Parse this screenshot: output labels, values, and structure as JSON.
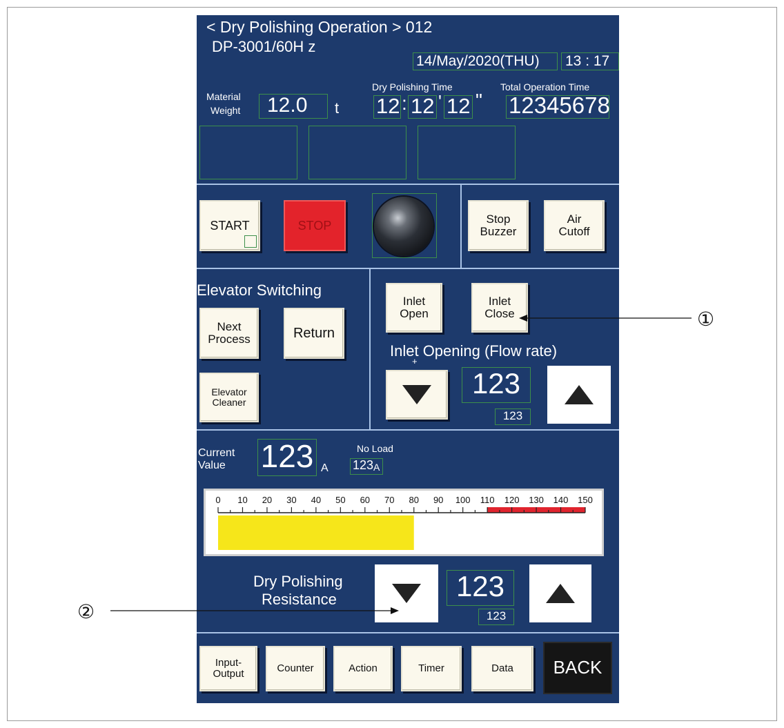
{
  "header": {
    "title": "< Dry Polishing Operation > 012",
    "model": "DP-3001/60H z",
    "date": "14/May/2020(THU)",
    "time": "13 : 17",
    "material_weight_label_1": "Material",
    "material_weight_label_2": "Weight",
    "material_weight_value": "12.0",
    "material_weight_unit": "t",
    "dry_polishing_time_label": "Dry Polishing Time",
    "dry_polishing_time_h": "12",
    "dry_polishing_time_m": "12",
    "dry_polishing_time_s": "12",
    "total_operation_time_label": "Total Operation Time",
    "total_operation_time_value": "12345678"
  },
  "controls": {
    "start_label": "START",
    "stop_label": "STOP",
    "stop_buzzer_label": "Stop Buzzer",
    "air_cutoff_label": "Air Cutoff"
  },
  "elevator": {
    "title": "Elevator Switching",
    "next_process_label": "Next Process",
    "return_label": "Return",
    "elevator_cleaner_label": "Elevator Cleaner"
  },
  "inlet": {
    "open_label": "Inlet Open",
    "close_label": "Inlet Close",
    "opening_label": "Inlet Opening (Flow rate)",
    "value": "123",
    "sub_value": "123"
  },
  "current": {
    "label_1": "Current",
    "label_2": "Value",
    "value": "123",
    "unit": "A",
    "no_load_label": "No Load",
    "no_load_value": "123",
    "no_load_unit": "A"
  },
  "gauge": {
    "scale_labels": [
      "0",
      "10",
      "20",
      "30",
      "40",
      "50",
      "60",
      "70",
      "80",
      "90",
      "100",
      "110",
      "120",
      "130",
      "140",
      "150"
    ],
    "min": 0,
    "max": 150,
    "level": 80,
    "fill_color": "#f6e61a",
    "warning_from": 110,
    "warning_color": "#e0242e"
  },
  "resistance": {
    "label_1": "Dry Polishing",
    "label_2": "Resistance",
    "value": "123",
    "sub_value": "123"
  },
  "bottom_nav": {
    "input_output_label": "Input-\nOutput",
    "counter_label": "Counter",
    "action_label": "Action",
    "timer_label": "Timer",
    "data_label": "Data",
    "back_label": "BACK"
  },
  "callouts": {
    "callout_1": "①",
    "callout_2": "②"
  },
  "colors": {
    "panel_bg": "#1d3a6c",
    "stop_button": "#e3232b",
    "back_button": "#151515"
  }
}
